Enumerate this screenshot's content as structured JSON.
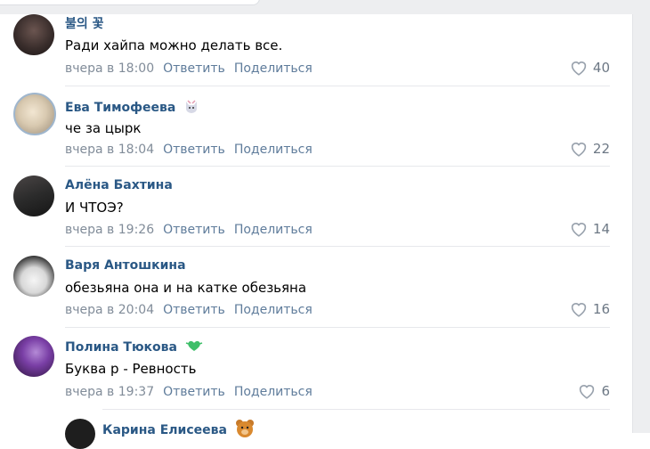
{
  "comments": [
    {
      "name": "불의 꽃",
      "text": "Ради хайпа можно делать все.",
      "date": "вчера в 18:00",
      "reply": "Ответить",
      "share": "Поделиться",
      "likes": "40",
      "avatar_color": "#3a2e2c"
    },
    {
      "name": "Ева Тимофеева",
      "text": "че за цырк",
      "date": "вчера в 18:04",
      "reply": "Ответить",
      "share": "Поделиться",
      "likes": "22",
      "avatar_color": "#d8c9b0",
      "badge": "cat-emoji"
    },
    {
      "name": "Алёна Бахтина",
      "text": "И ЧТОЭ?",
      "date": "вчера в 19:26",
      "reply": "Ответить",
      "share": "Поделиться",
      "likes": "14",
      "avatar_color": "#2b2b2b"
    },
    {
      "name": "Варя Антошкина",
      "text": "обезьяна она и на катке обезьяна",
      "date": "вчера в 20:04",
      "reply": "Ответить",
      "share": "Поделиться",
      "likes": "16",
      "avatar_color": "#e8e8e8"
    },
    {
      "name": "Полина Тюкова",
      "text": "Буква р - Ревность",
      "date": "вчера в 19:37",
      "reply": "Ответить",
      "share": "Поделиться",
      "likes": "6",
      "avatar_color": "#5a2a7a",
      "badge": "green-heart-emoji"
    },
    {
      "name": "Карина Елисеева",
      "avatar_color": "#1e1e1e",
      "badge": "bear-emoji"
    }
  ],
  "colors": {
    "name": "#2a5885",
    "action": "#5f7c9b",
    "meta": "#818c99"
  }
}
